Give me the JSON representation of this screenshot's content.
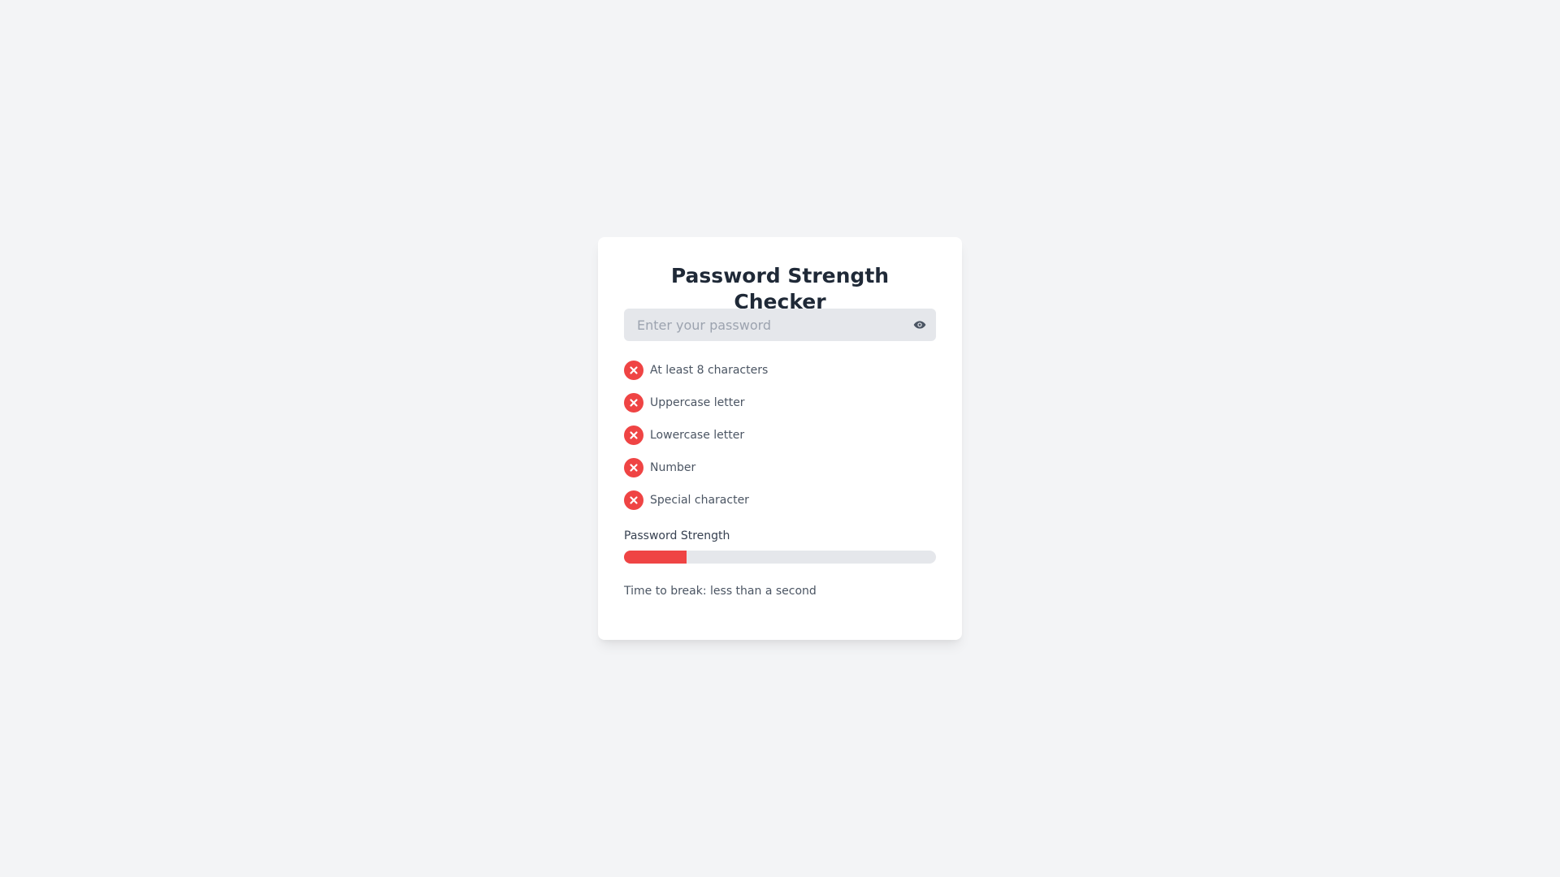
{
  "card": {
    "title": "Password Strength Checker"
  },
  "password": {
    "value": "",
    "placeholder": "Enter your password",
    "toggle_icon": "eye-icon"
  },
  "requirements": [
    {
      "label": "At least 8 characters",
      "met": false,
      "icon": "x-circle-icon"
    },
    {
      "label": "Uppercase letter",
      "met": false,
      "icon": "x-circle-icon"
    },
    {
      "label": "Lowercase letter",
      "met": false,
      "icon": "x-circle-icon"
    },
    {
      "label": "Number",
      "met": false,
      "icon": "x-circle-icon"
    },
    {
      "label": "Special character",
      "met": false,
      "icon": "x-circle-icon"
    }
  ],
  "strength": {
    "label": "Password Strength",
    "level": 0.2,
    "color": "#ef4444"
  },
  "time_to_break": "Time to break: less than a second",
  "colors": {
    "background": "#f3f4f6",
    "fail": "#ef4444",
    "input_bg": "#e5e7eb"
  }
}
